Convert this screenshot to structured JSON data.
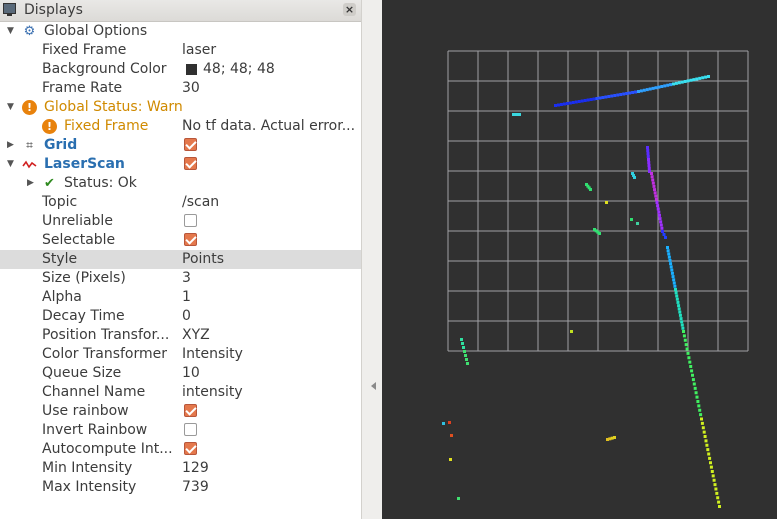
{
  "panel": {
    "title": "Displays",
    "close_icon": "close-icon"
  },
  "tree": {
    "global_options": "Global Options",
    "fixed_frame_label": "Fixed Frame",
    "fixed_frame_value": "laser",
    "background_color_label": "Background Color",
    "background_color_value": "48; 48; 48",
    "background_color_hex": "#303030",
    "frame_rate_label": "Frame Rate",
    "frame_rate_value": "30",
    "global_status": "Global Status: Warn",
    "fixed_frame_warn_label": "Fixed Frame",
    "fixed_frame_warn_value": "No tf data.  Actual error...",
    "grid": "Grid",
    "laserscan": "LaserScan",
    "status_ok": "Status: Ok",
    "topic_label": "Topic",
    "topic_value": "/scan",
    "unreliable_label": "Unreliable",
    "selectable_label": "Selectable",
    "style_label": "Style",
    "style_value": "Points",
    "size_label": "Size (Pixels)",
    "size_value": "3",
    "alpha_label": "Alpha",
    "alpha_value": "1",
    "decay_label": "Decay Time",
    "decay_value": "0",
    "position_transformer_label": "Position Transfor...",
    "position_transformer_value": "XYZ",
    "color_transformer_label": "Color Transformer",
    "color_transformer_value": "Intensity",
    "queue_size_label": "Queue Size",
    "queue_size_value": "10",
    "channel_name_label": "Channel Name",
    "channel_name_value": "intensity",
    "use_rainbow_label": "Use rainbow",
    "invert_rainbow_label": "Invert Rainbow",
    "autocompute_label": "Autocompute Int...",
    "min_intensity_label": "Min Intensity",
    "min_intensity_value": "129",
    "max_intensity_label": "Max Intensity",
    "max_intensity_value": "739"
  },
  "checkboxes": {
    "grid_enabled": true,
    "laserscan_enabled": true,
    "unreliable": false,
    "selectable": true,
    "use_rainbow": true,
    "invert_rainbow": false,
    "autocompute": true
  },
  "colors": {
    "viewport_bg": "#303030",
    "grid_line": "#a0a0a4",
    "warn": "#d08a00",
    "accent": "#2a6fb0",
    "checkbox_on": "#e4784c"
  }
}
